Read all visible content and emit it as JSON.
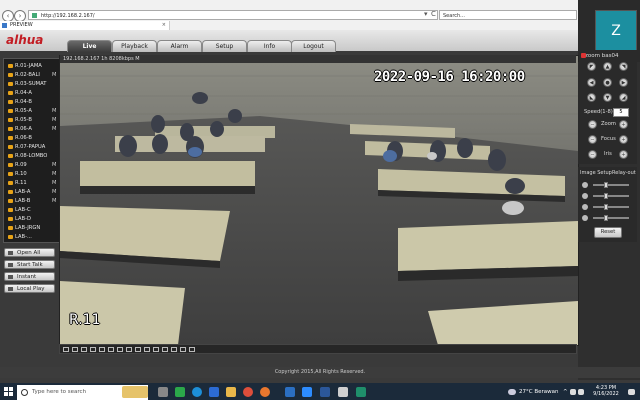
{
  "browser": {
    "url": "http://192.168.2.167/",
    "search_placeholder": "Search...",
    "tab_title": "PREVIEW",
    "tab_close": "×",
    "refresh": "C",
    "dropdown": "▾"
  },
  "zoom": {
    "avatar_letter": "Z",
    "participant": "zoom bas04"
  },
  "app": {
    "logo": "alhua",
    "tabs": [
      "Live",
      "Playback",
      "Alarm",
      "Setup",
      "Info",
      "Logout"
    ],
    "active_tab": "Live"
  },
  "channels": [
    {
      "name": "R.01-JAMA",
      "mark": ""
    },
    {
      "name": "R.02-BALI",
      "mark": "M"
    },
    {
      "name": "R.03-SUMAT",
      "mark": ""
    },
    {
      "name": "R.04-A",
      "mark": ""
    },
    {
      "name": "R.04-B",
      "mark": ""
    },
    {
      "name": "R.05-A",
      "mark": "M"
    },
    {
      "name": "R.05-B",
      "mark": "M"
    },
    {
      "name": "R.06-A",
      "mark": "M"
    },
    {
      "name": "R.06-B",
      "mark": ""
    },
    {
      "name": "R.07-PAPUA",
      "mark": ""
    },
    {
      "name": "R.08-LOMBO",
      "mark": ""
    },
    {
      "name": "R.09",
      "mark": "M"
    },
    {
      "name": "R.10",
      "mark": "M"
    },
    {
      "name": "R.11",
      "mark": "M"
    },
    {
      "name": "LAB-A",
      "mark": "M"
    },
    {
      "name": "LAB-B",
      "mark": "M"
    },
    {
      "name": "LAB-C",
      "mark": ""
    },
    {
      "name": "LAB-D",
      "mark": ""
    },
    {
      "name": "LAB-JRGN",
      "mark": ""
    },
    {
      "name": "LAB-...",
      "mark": ""
    }
  ],
  "left_buttons": {
    "open_all": "Open All",
    "start_talk": "Start Talk",
    "instant_record": "Instant Record",
    "local_play": "Local Play"
  },
  "video": {
    "stream_info": "192.168.2.167 1h 8208kbps  M",
    "timestamp": "2022-09-16 16:20:00",
    "camera_label": "R.11"
  },
  "ptz": {
    "speed_label": "Speed(1-8)",
    "speed_value": "5",
    "zoom_label": "Zoom",
    "focus_label": "Focus",
    "iris_label": "Iris",
    "minus": "−",
    "plus": "+"
  },
  "image_setup": {
    "title": "Image Setup",
    "relay": "Relay-out",
    "reset": "Reset",
    "sliders": [
      0.35,
      0.35,
      0.35,
      0.35
    ]
  },
  "footer": {
    "copyright": "Copyright 2015,All Rights Reserved."
  },
  "taskbar": {
    "search_placeholder": "Type here to search",
    "weather": "27°C  Berawan",
    "time": "4:23 PM",
    "date": "9/16/2022",
    "tray_arrow": "^"
  }
}
